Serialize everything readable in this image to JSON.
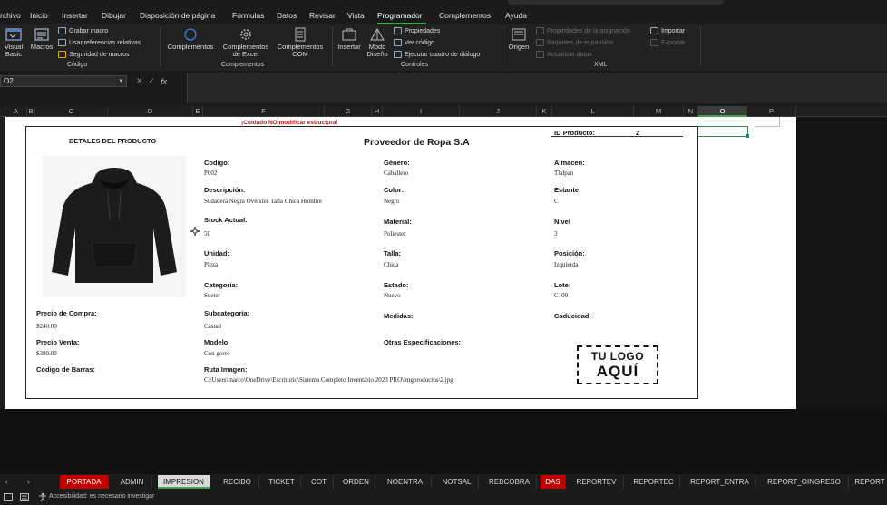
{
  "menu": {
    "items": [
      "rchivo",
      "Inicio",
      "Insertar",
      "Dibujar",
      "Disposición de página",
      "Fórmulas",
      "Datos",
      "Revisar",
      "Vista",
      "Programador",
      "Complementos",
      "Ayuda"
    ],
    "active": "Programador"
  },
  "ribbon": {
    "codigo": {
      "label": "Código",
      "visual_basic": "Visual Basic",
      "macros": "Macros",
      "grabar_macro": "Grabar macro",
      "usar_referencias": "Usar referencias relativas",
      "seguridad": "Seguridad de macros"
    },
    "complementos": {
      "label": "Complementos",
      "complementos": "Complementos",
      "excel": "Complementos de Excel",
      "com": "Complementos COM"
    },
    "controles": {
      "label": "Controles",
      "insertar": "Insertar",
      "modo_diseno": "Modo Diseño",
      "propiedades": "Propiedades",
      "ver_codigo": "Ver código",
      "ejecutar": "Ejecutar cuadro de diálogo"
    },
    "xml": {
      "label": "XML",
      "origen": "Origen",
      "propiedades_asignacion": "Propiedades de la asignación",
      "paquetes": "Paquetes de expansión",
      "actualizar": "Actualizar datos",
      "importar": "Importar",
      "exportar": "Exportar"
    }
  },
  "formula_bar": {
    "name_box": "O2",
    "fx": "fx",
    "formula": ""
  },
  "columns": [
    "A",
    "B",
    "C",
    "D",
    "E",
    "F",
    "G",
    "H",
    "I",
    "J",
    "K",
    "L",
    "M",
    "N",
    "O",
    "P"
  ],
  "selected_column": "O",
  "sheet": {
    "warning": "¡Cuidado NO modificar estructura!",
    "detalles_title": "DETALES DEL PRODUCTO",
    "proveedor_title": "Proveedor de Ropa S.A",
    "id_label": "ID Producto:",
    "id_value": "2",
    "fields": {
      "codigo": {
        "label": "Codigo:",
        "value": "P002"
      },
      "descripcion": {
        "label": "Descripción:",
        "value": "Sudadera Negra Oversize Talla Chica Hombre"
      },
      "stock": {
        "label": "Stock Actual:",
        "value": "50"
      },
      "unidad": {
        "label": "Unidad:",
        "value": "Pieza"
      },
      "categoria": {
        "label": "Categoría:",
        "value": "Sueter"
      },
      "subcategoria": {
        "label": "Subcategoría:",
        "value": "Casual"
      },
      "modelo": {
        "label": "Modelo:",
        "value": "Con gorro"
      },
      "ruta": {
        "label": "Ruta Imagen:",
        "value": "C:\\Users\\marco\\OneDrive\\Escritorio\\Sistema Completo Inventario 2023 PRO\\imgproductos\\2.jpg"
      },
      "genero": {
        "label": "Género:",
        "value": "Caballero"
      },
      "color": {
        "label": "Color:",
        "value": "Negro"
      },
      "material": {
        "label": "Material:",
        "value": "Poliester"
      },
      "talla": {
        "label": "Talla:",
        "value": "Chica"
      },
      "estado": {
        "label": "Estado:",
        "value": "Nuevo"
      },
      "medidas": {
        "label": "Medidas:",
        "value": ""
      },
      "otras": {
        "label": "Otras Especificaciones:",
        "value": ""
      },
      "almacen": {
        "label": "Almacen:",
        "value": "Tlalpan"
      },
      "estante": {
        "label": "Estante:",
        "value": "C"
      },
      "nivel": {
        "label": "Nivel",
        "value": "3"
      },
      "posicion": {
        "label": "Posición:",
        "value": "Izquierda"
      },
      "lote": {
        "label": "Lote:",
        "value": "C100"
      },
      "caducidad": {
        "label": "Caducidad:",
        "value": ""
      },
      "precio_compra": {
        "label": "Precio de Compra:",
        "value": "$240.00"
      },
      "precio_venta": {
        "label": "Precio Venta:",
        "value": "$380.00"
      },
      "codigo_barras": {
        "label": "Codigo de Barras:",
        "value": ""
      }
    },
    "logo": {
      "line1": "TU LOGO",
      "line2": "AQUÍ"
    },
    "product_image_icon": "hoodie-image"
  },
  "tabs": [
    "PORTADA",
    "ADMIN",
    "IMPRESION",
    "RECIBO",
    "TICKET",
    "COT",
    "ORDEN",
    "NOENTRA",
    "NOTSAL",
    "REBCOBRA",
    "DAS",
    "REPORTEV",
    "REPORTEC",
    "REPORT_ENTRA",
    "REPORT_OINGRESO",
    "REPORT"
  ],
  "active_tab": "IMPRESION",
  "red_tabs": [
    "PORTADA",
    "DAS"
  ],
  "status": {
    "accessibility": "Accesibilidad: es necesario investigar"
  },
  "colors": {
    "accent": "#3fa34d",
    "tab_red": "#c00000",
    "warning": "#d01010"
  }
}
